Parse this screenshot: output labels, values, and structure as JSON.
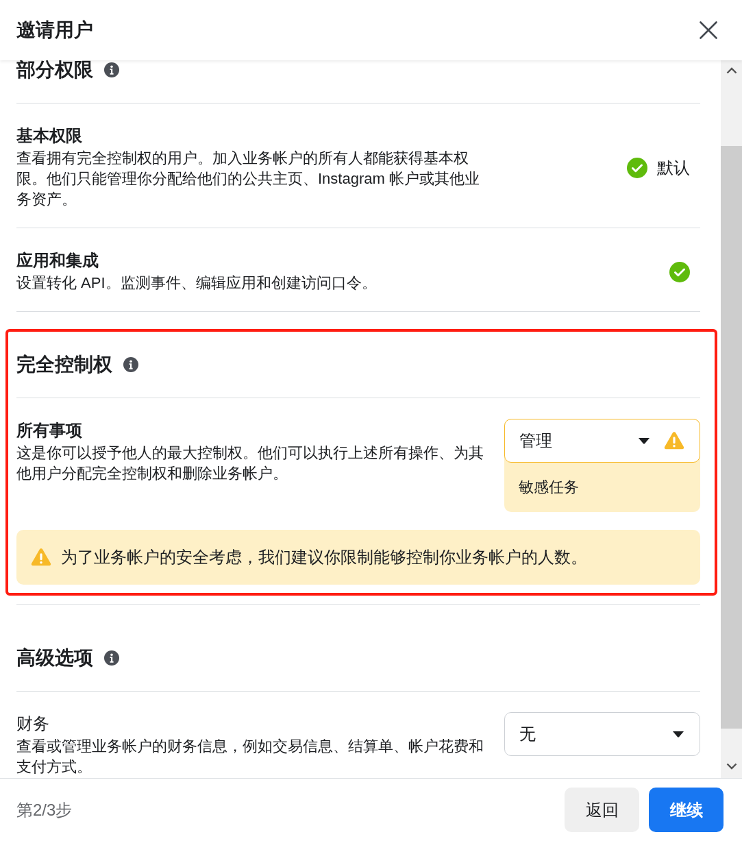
{
  "dialog": {
    "title": "邀请用户"
  },
  "sections": [
    {
      "kind": "permissions",
      "heading": "部分权限",
      "highlighted": false,
      "rows": [
        {
          "kind": "status",
          "title": "基本权限",
          "description": "查看拥有完全控制权的用户。加入业务帐户的所有人都能获得基本权限。他们只能管理你分配给他们的公共主页、Instagram 帐户或其他业务资产。",
          "status": {
            "checked": true,
            "label": "默认"
          }
        },
        {
          "kind": "status",
          "title": "应用和集成",
          "description": "设置转化 API。监测事件、编辑应用和创建访问口令。",
          "status": {
            "checked": true
          }
        }
      ]
    },
    {
      "kind": "permissions",
      "heading": "完全控制权",
      "highlighted": true,
      "rows": [
        {
          "kind": "select",
          "title": "所有事项",
          "description": "这是你可以授予他人的最大控制权。他们可以执行上述所有操作、为其他用户分配完全控制权和删除业务帐户。",
          "select": {
            "value": "管理",
            "warning": true,
            "note": "敏感任务"
          }
        }
      ],
      "alert": "为了业务帐户的安全考虑，我们建议你限制能够控制你业务帐户的人数。"
    },
    {
      "kind": "advanced",
      "heading": "高级选项",
      "highlighted": false,
      "rows": [
        {
          "kind": "select",
          "title": "财务",
          "description": "查看或管理业务帐户的财务信息，例如交易信息、结算单、帐户花费和支付方式。",
          "select": {
            "value": "无",
            "warning": false
          }
        }
      ]
    }
  ],
  "footer": {
    "step": "第2/3步",
    "buttons": [
      {
        "label": "返回",
        "kind": "secondary"
      },
      {
        "label": "继续",
        "kind": "primary"
      }
    ]
  }
}
